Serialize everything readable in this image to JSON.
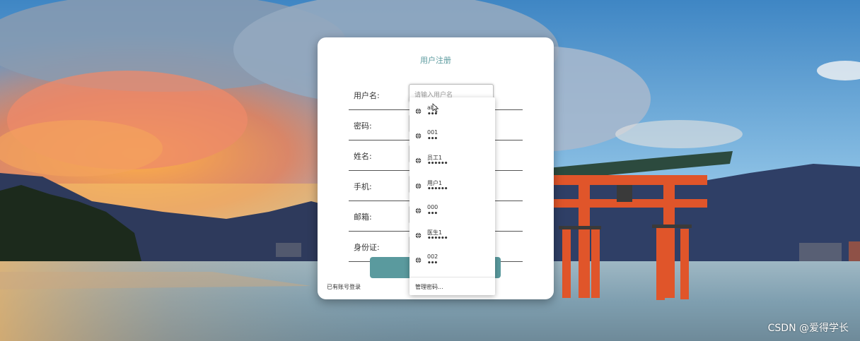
{
  "form": {
    "title": "用户注册",
    "fields": [
      {
        "label": "用户名:",
        "placeholder": "请输入用户名"
      },
      {
        "label": "密码:"
      },
      {
        "label": "姓名:"
      },
      {
        "label": "手机:"
      },
      {
        "label": "邮箱:"
      },
      {
        "label": "身份证:"
      }
    ],
    "login_link": "已有账号登录",
    "submit_button_color": "#5a9a9e"
  },
  "autofill_dropdown": {
    "items": [
      {
        "username": "abc",
        "password_mask": "•••",
        "icon": "globe-icon"
      },
      {
        "username": "001",
        "password_mask": "•••",
        "icon": "globe-icon"
      },
      {
        "username": "员工1",
        "password_mask": "••••••",
        "icon": "globe-icon"
      },
      {
        "username": "用户1",
        "password_mask": "••••••",
        "icon": "globe-icon"
      },
      {
        "username": "000",
        "password_mask": "•••",
        "icon": "globe-icon"
      },
      {
        "username": "医生1",
        "password_mask": "••••••",
        "icon": "globe-icon"
      },
      {
        "username": "002",
        "password_mask": "•••",
        "icon": "globe-icon"
      }
    ],
    "manage_label": "管理密码..."
  },
  "watermark": "CSDN @爱得学长",
  "colors": {
    "accent": "#5a9a9e",
    "card_bg": "#ffffff"
  }
}
